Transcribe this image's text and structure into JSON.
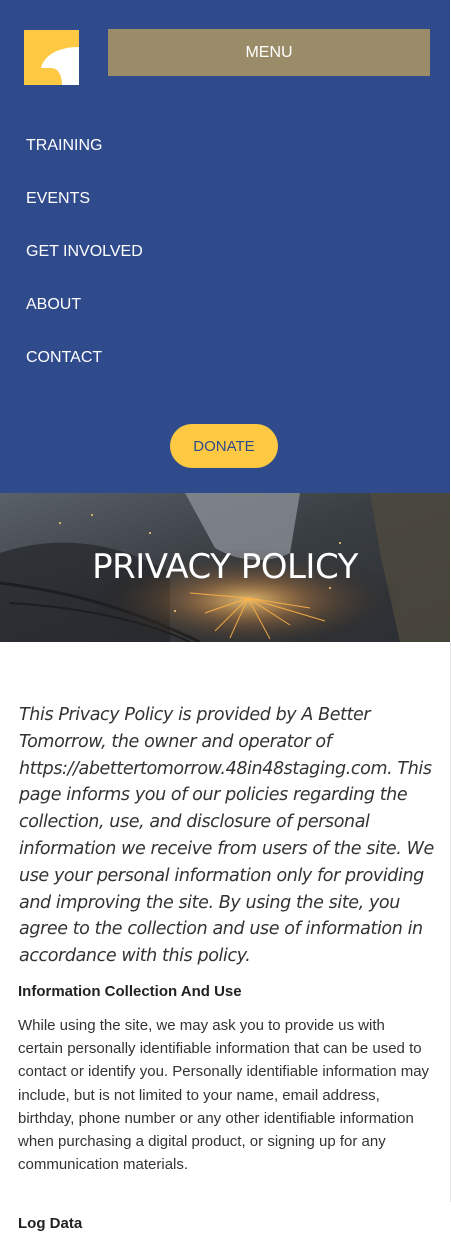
{
  "header": {
    "logo_label": "A Better Tomorrow logo",
    "menu_label": "MENU",
    "nav": [
      {
        "label": "TRAINING"
      },
      {
        "label": "EVENTS"
      },
      {
        "label": "GET INVOLVED"
      },
      {
        "label": "ABOUT"
      },
      {
        "label": "CONTACT"
      }
    ],
    "donate_label": "DONATE"
  },
  "hero": {
    "title": "PRIVACY POLICY",
    "image": "worker-grinding-metal-sparks"
  },
  "content": {
    "intro": "This Privacy Policy is provided by A Better Tomorrow, the owner and operator of https://abettertomorrow.48in48staging.com. This page informs you of our policies regarding the collection, use, and disclosure of personal information we receive from users of the site. We use your personal information only for providing and improving the site. By using the site, you agree to the collection and use of information in accordance with this policy.",
    "sections": [
      {
        "heading": "Information Collection And Use",
        "body": "While using the site, we may ask you to provide us with certain personally identifiable information that can be used to contact or identify you. Personally identifiable information may include, but is not limited to your name, email address, birthday, phone number or any other identifiable information when purchasing a digital product, or signing up for any communication materials."
      },
      {
        "heading": "Log Data",
        "body": ""
      }
    ]
  },
  "colors": {
    "header_bg": "#304b8c",
    "menu_button_bg": "#9a8c68",
    "accent_yellow": "#fdc942",
    "text": "#333333"
  }
}
